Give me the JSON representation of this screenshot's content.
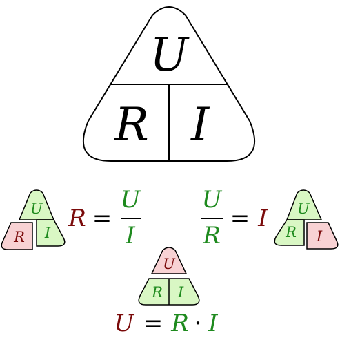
{
  "colors": {
    "stroke": "#000000",
    "green_fill": "#d9f7c4",
    "red_fill": "#f8d2d4",
    "green_text": "#1e8a1e",
    "red_text": "#7a0a0a",
    "black_text": "#000000"
  },
  "main_triangle": {
    "top": "U",
    "bottom_left": "R",
    "bottom_right": "I"
  },
  "triangles": {
    "find_r": {
      "top": "U",
      "bottom_left": "R",
      "bottom_right": "I"
    },
    "find_i": {
      "top": "U",
      "bottom_left": "R",
      "bottom_right": "I"
    },
    "find_u": {
      "top": "U",
      "bottom_left": "R",
      "bottom_right": "I"
    }
  },
  "formulas": {
    "r": {
      "lhs": "R",
      "eq": "=",
      "num": "U",
      "den": "I"
    },
    "i": {
      "num": "U",
      "den": "R",
      "eq": "=",
      "rhs": "I"
    },
    "u": {
      "lhs": "U",
      "eq": "=",
      "a": "R",
      "dot": "·",
      "b": "I"
    }
  }
}
